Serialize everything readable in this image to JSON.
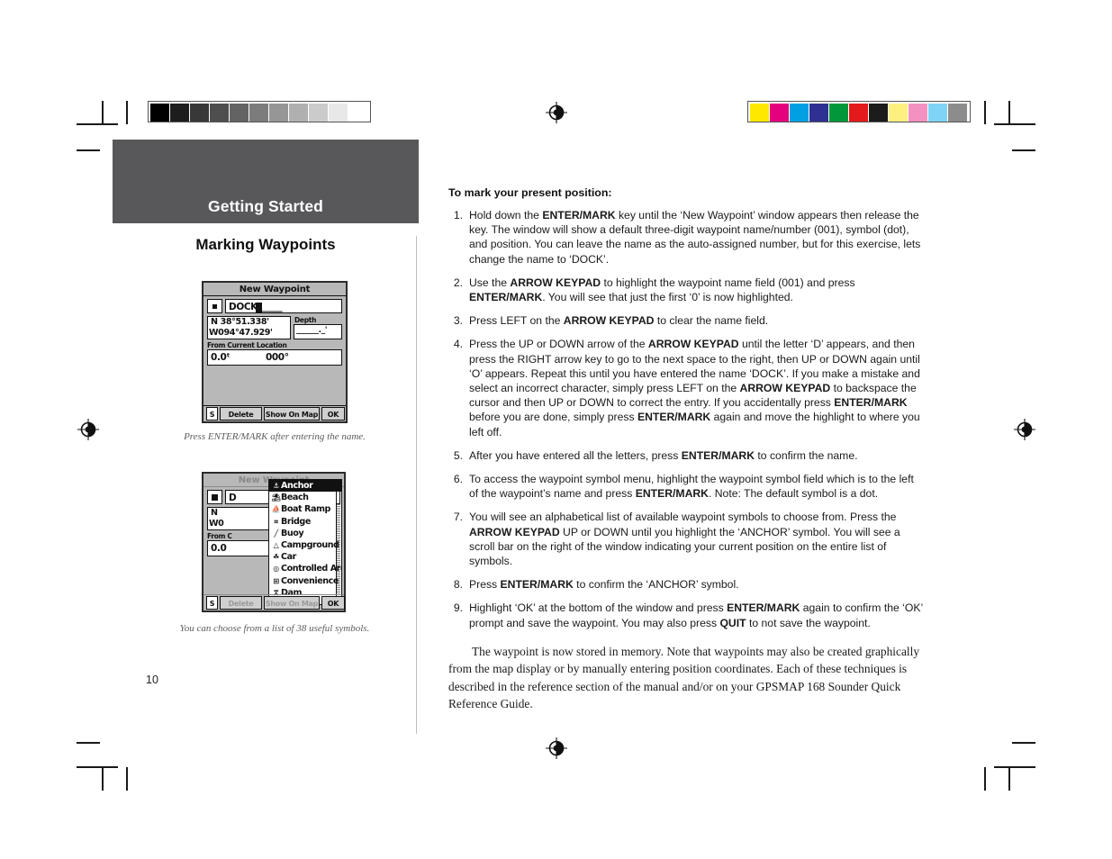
{
  "page": {
    "number": "10",
    "header_band_title": "Getting Started",
    "section_title": "Marking Waypoints"
  },
  "printer_marks": {
    "grayscale_bar": {
      "name": "grayscale-step-wedge",
      "swatches": [
        "#000000",
        "#1d1d1d",
        "#383838",
        "#4e4e4e",
        "#636363",
        "#7c7c7c",
        "#969696",
        "#b0b0b0",
        "#cbcbcb",
        "#e8e8e8",
        "#ffffff"
      ]
    },
    "color_bar": {
      "name": "color-control-bar",
      "swatches": [
        "#ffe800",
        "#e5007d",
        "#00a0e3",
        "#2e3192",
        "#00983a",
        "#e3191c",
        "#1c1c1c",
        "#fdf07f",
        "#f391c0",
        "#7fd4f5",
        "#8c8c8c"
      ]
    },
    "registration_icon": "registration-target-icon"
  },
  "figures": [
    {
      "name": "new-waypoint-screen",
      "title": "New Waypoint",
      "name_field": "DOCK",
      "name_field_fill": "_____",
      "latitude": "N  38°51.338'",
      "longitude": "W094°47.929'",
      "depth_label": "Depth",
      "depth_value": "______._'",
      "from_label": "From Current Location",
      "distance": "0.0ᵗ",
      "bearing": "000°",
      "buttons": [
        "S",
        "Delete",
        "Show On Map",
        "OK"
      ],
      "caption": "Press ENTER/MARK after entering the name."
    },
    {
      "name": "waypoint-symbol-list-screen",
      "title": "New Waypoint",
      "caption": "You can choose from a list of 38 useful symbols.",
      "symbols": [
        {
          "icon": "anchor-icon",
          "glyph": "⚓",
          "label": "Anchor",
          "selected": true
        },
        {
          "icon": "beach-icon",
          "glyph": "⛱",
          "label": "Beach",
          "selected": false
        },
        {
          "icon": "boat-ramp-icon",
          "glyph": "⛵",
          "label": "Boat Ramp",
          "selected": false
        },
        {
          "icon": "bridge-icon",
          "glyph": "⌗",
          "label": "Bridge",
          "selected": false
        },
        {
          "icon": "buoy-icon",
          "glyph": "╱",
          "label": "Buoy",
          "selected": false
        },
        {
          "icon": "campground-icon",
          "glyph": "△",
          "label": "Campground",
          "selected": false
        },
        {
          "icon": "car-icon",
          "glyph": "☘",
          "label": "Car",
          "selected": false
        },
        {
          "icon": "controlled-area-icon",
          "glyph": "◎",
          "label": "Controlled Area",
          "selected": false
        },
        {
          "icon": "convenience-store-icon",
          "glyph": "⊞",
          "label": "Convenience Stor",
          "selected": false
        },
        {
          "icon": "dam-icon",
          "glyph": "⩞",
          "label": "Dam",
          "selected": false
        }
      ]
    }
  ],
  "content": {
    "lead": "To mark your present position:",
    "steps": [
      {
        "num": "1.",
        "html": "Hold down the <b>ENTER/MARK</b> key until the ‘New Waypoint’ window appears then release the key. The window will show a default three-digit waypoint name/number (001), symbol (dot), and position. You can leave the name as the auto-assigned number, but for this exercise, lets change the name to ‘DOCK’."
      },
      {
        "num": "2.",
        "html": "Use the <b>ARROW KEYPAD</b> to highlight the waypoint name field (001) and press <b>ENTER/MARK</b>. You will see that just the first ‘0’ is now highlighted."
      },
      {
        "num": "3.",
        "html": "Press LEFT on the <b>ARROW KEYPAD</b> to clear the name field."
      },
      {
        "num": "4.",
        "html": "Press the UP or DOWN arrow of the <b>ARROW KEYPAD</b> until the letter ‘D’ appears, and then press the RIGHT arrow key to go to the next space to the right, then UP or DOWN again until ‘O’ appears. Repeat this until you have entered the name ‘DOCK’. If you make a mistake and select an incorrect character, simply press LEFT on the <b>ARROW KEYPAD</b> to backspace the cursor and then UP or DOWN to correct the entry. If you accidentally press <b>ENTER/MARK</b> before you are done, simply press <b>ENTER/MARK</b> again and move the highlight to where you left off."
      },
      {
        "num": "5.",
        "html": "After you have entered all the letters, press <b>ENTER/MARK</b> to confirm the name."
      },
      {
        "num": "6.",
        "html": "To access the waypoint symbol menu, highlight the waypoint symbol field which is to the left of the waypoint’s name and press <b>ENTER/MARK</b>. Note: The default symbol is a dot."
      },
      {
        "num": "7.",
        "html": "You will see an alphabetical list of available waypoint symbols to choose from. Press the <b>ARROW KEYPAD</b> UP or DOWN until you highlight the ‘ANCHOR’ symbol. You will see a scroll bar on the right of the window indicating your current position on the entire list of symbols."
      },
      {
        "num": "8.",
        "html": "Press <b>ENTER/MARK</b> to confirm the ‘ANCHOR’ symbol."
      },
      {
        "num": "9.",
        "html": "Highlight ‘OK’ at the bottom of the window and press <b>ENTER/MARK</b> again to confirm the ‘OK’ prompt and save the waypoint. You may also press <b>QUIT</b> to not save the waypoint."
      }
    ],
    "closing": "The waypoint is now stored in memory.  Note that waypoints may also be created graphically from the map display or by manually entering position coordinates.  Each of these techniques is described in the reference section of the manual and/or on your GPSMAP 168 Sounder Quick Reference Guide."
  }
}
